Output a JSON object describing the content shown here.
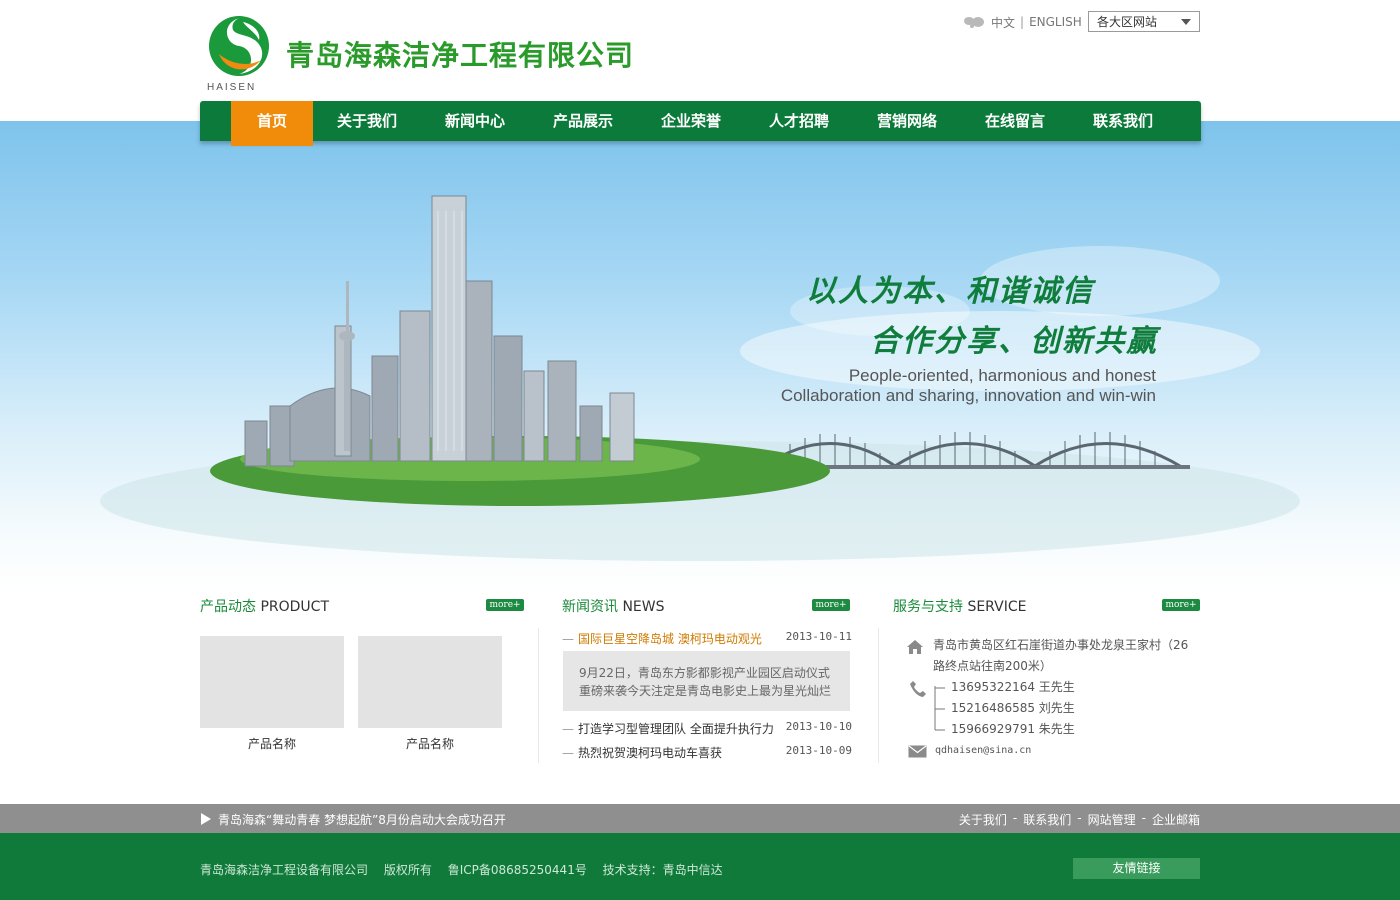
{
  "header": {
    "company_name": "青岛海森洁净工程有限公司",
    "logo_word": "HAISEN",
    "lang_cn": "中文",
    "lang_en": "ENGLISH",
    "region_select": "各大区网站"
  },
  "nav": {
    "items": [
      "首页",
      "关于我们",
      "新闻中心",
      "产品展示",
      "企业荣誉",
      "人才招聘",
      "营销网络",
      "在线留言",
      "联系我们"
    ],
    "active_index": 0
  },
  "banner": {
    "slogan_cn_1": "以人为本、和谐诚信",
    "slogan_cn_2": "合作分享、创新共赢",
    "slogan_en_1": "People-oriented, harmonious and honest",
    "slogan_en_2": "Collaboration and sharing, innovation and win-win"
  },
  "product": {
    "title_cn": "产品动态",
    "title_en": "PRODUCT",
    "more": "more+",
    "items": [
      {
        "name": "产品名称"
      },
      {
        "name": "产品名称"
      }
    ]
  },
  "news": {
    "title_cn": "新闻资讯",
    "title_en": "NEWS",
    "more": "more+",
    "items": [
      {
        "title": "国际巨星空降岛城 澳柯玛电动观光",
        "date": "2013-10-11"
      },
      {
        "title": "打造学习型管理团队 全面提升执行力",
        "date": "2013-10-10"
      },
      {
        "title": "热烈祝贺澳柯玛电动车喜获",
        "date": "2013-10-09"
      }
    ],
    "summary": "9月22日，青岛东方影都影视产业园区启动仪式重磅来袭今天注定是青岛电影史上最为星光灿烂"
  },
  "service": {
    "title_cn": "服务与支持",
    "title_en": "SERVICE",
    "more": "more+",
    "address": "青岛市黄岛区红石崖街道办事处龙泉王家村（26路终点站往南200米）",
    "phones": [
      "13695322164 王先生",
      "15216486585 刘先生",
      "15966929791 朱先生"
    ],
    "email": "qdhaisen@sina.cn"
  },
  "strip": {
    "notice": "青岛海森“舞动青春 梦想起航”8月份启动大会成功召开",
    "links": [
      "关于我们",
      "联系我们",
      "网站管理",
      "企业邮箱"
    ],
    "sep": "-"
  },
  "footer": {
    "company": "青岛海森洁净工程设备有限公司",
    "rights": "版权所有",
    "icp": "鲁ICP备08685250441号",
    "support": "技术支持：青岛中信达",
    "friend_links": "友情链接"
  },
  "colors": {
    "brand_green": "#0c7a3a",
    "nav_active": "#f18b0a",
    "news_hot": "#d07a00"
  }
}
